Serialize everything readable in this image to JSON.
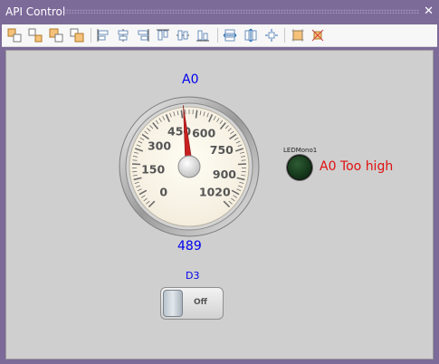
{
  "window": {
    "title": "API Control",
    "close_glyph": "✕"
  },
  "toolbar": {
    "icons": [
      "align-to-grid-icon",
      "group-icon",
      "bring-front-icon",
      "send-back-icon",
      "align-left-icon",
      "align-center-icon",
      "align-right-icon",
      "align-top-icon",
      "align-middle-icon",
      "align-bottom-icon",
      "make-same-width-icon",
      "make-same-height-icon",
      "make-same-size-icon",
      "snap-icon",
      "crop-icon"
    ]
  },
  "gauge": {
    "title": "A0",
    "value_label": "489",
    "value": 489,
    "min": 0,
    "max": 1020,
    "tick_labels": [
      "0",
      "150",
      "300",
      "450",
      "600",
      "750",
      "900",
      "1020"
    ],
    "tick_values": [
      0,
      150,
      300,
      450,
      600,
      750,
      900,
      1020
    ]
  },
  "led": {
    "label": "LEDMono1",
    "state": "off",
    "color": "#163a1c"
  },
  "alert": {
    "text": "A0 Too high",
    "color": "#e01010"
  },
  "switch": {
    "title": "D3",
    "state_label": "Off"
  }
}
